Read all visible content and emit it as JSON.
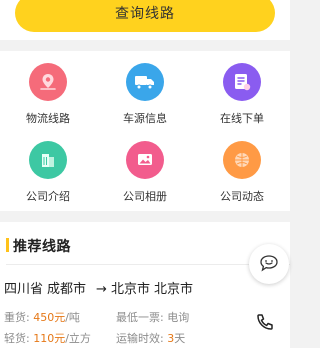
{
  "query_button_label": "查询线路",
  "grid": [
    {
      "label": "物流线路",
      "icon": "location-route-icon",
      "color": "#f56b7a"
    },
    {
      "label": "车源信息",
      "icon": "truck-icon",
      "color": "#3aa6ea"
    },
    {
      "label": "在线下单",
      "icon": "order-form-icon",
      "color": "#8a5cf0"
    },
    {
      "label": "公司介绍",
      "icon": "building-icon",
      "color": "#3dc8a3"
    },
    {
      "label": "公司相册",
      "icon": "photo-album-icon",
      "color": "#f25c8d"
    },
    {
      "label": "公司动态",
      "icon": "globe-icon",
      "color": "#ff9a45"
    }
  ],
  "section": {
    "title": "推荐线路",
    "route": {
      "from_province": "四川省",
      "from_city": "成都市",
      "arrow": "→",
      "to_province": "北京市",
      "to_city": "北京市"
    },
    "heavy_label": "重货: ",
    "heavy_value": "450元",
    "heavy_unit": "/吨",
    "min_label": "最低一票: ",
    "min_value": "电询",
    "light_label": "轻货: ",
    "light_value": "110元",
    "light_unit": "/立方",
    "time_label": "运输时效: ",
    "time_value": "3",
    "time_unit": "天"
  },
  "colors": {
    "accent": "#ffd21e",
    "highlight": "#e67817"
  }
}
